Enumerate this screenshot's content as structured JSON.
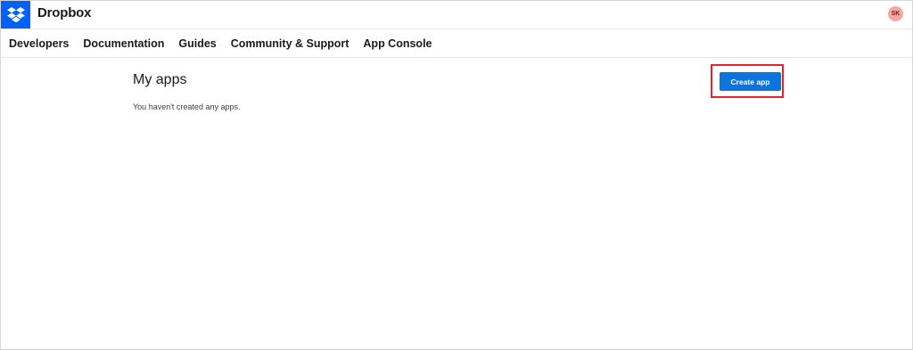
{
  "header": {
    "brand": "Dropbox",
    "logo_icon": "dropbox-logo-icon",
    "logo_bg_color": "#0061fe",
    "avatar_initials": "SK",
    "avatar_color": "#f5a7a0"
  },
  "nav": {
    "items": [
      {
        "label": "Developers"
      },
      {
        "label": "Documentation"
      },
      {
        "label": "Guides"
      },
      {
        "label": "Community & Support"
      },
      {
        "label": "App Console"
      }
    ]
  },
  "main": {
    "title": "My apps",
    "empty_message": "You haven't created any apps.",
    "create_button_label": "Create app",
    "button_color": "#0b74de",
    "highlight_color": "#e8222e"
  }
}
